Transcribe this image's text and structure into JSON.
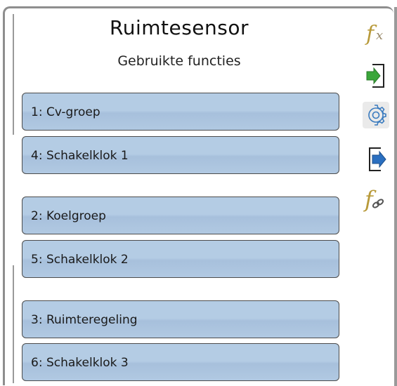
{
  "header": {
    "title": "Ruimtesensor",
    "subtitle": "Gebruikte functies"
  },
  "functions": [
    {
      "label": "1: Cv-groep"
    },
    {
      "label": "4: Schakelklok 1"
    },
    {
      "label": "2: Koelgroep"
    },
    {
      "label": "5: Schakelklok 2"
    },
    {
      "label": "3: Ruimteregeling"
    },
    {
      "label": "6: Schakelklok 3"
    }
  ],
  "sidebar": {
    "icons": [
      {
        "name": "function-fx-icon",
        "glyph": "fx"
      },
      {
        "name": "input-icon"
      },
      {
        "name": "settings-gear-icon",
        "active": true
      },
      {
        "name": "output-icon"
      },
      {
        "name": "function-link-icon"
      }
    ]
  },
  "colors": {
    "button_fill": "#b4cce4",
    "button_border": "#4c4c4c",
    "fx_gold": "#b89a3a",
    "input_arrow": "#3aa63a",
    "output_arrow": "#2a6fc0",
    "gear_blue": "#3a7bbf"
  }
}
